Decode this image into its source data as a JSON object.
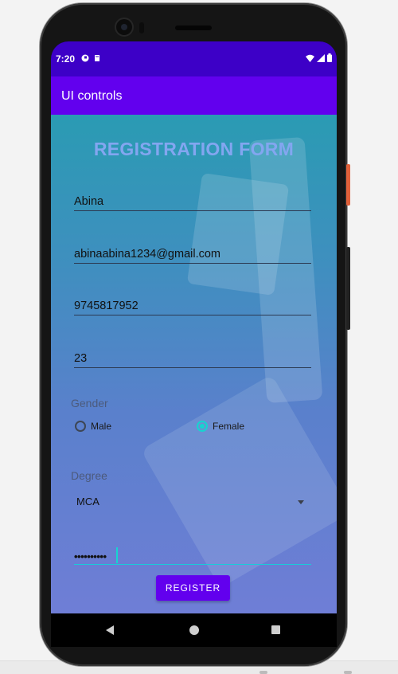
{
  "status_bar": {
    "time": "7:20"
  },
  "app_bar": {
    "title": "UI controls"
  },
  "form": {
    "title": "REGISTRATION FORM",
    "name": "Abina",
    "email": "abinaabina1234@gmail.com",
    "phone": "9745817952",
    "age": "23",
    "gender_label": "Gender",
    "gender_options": [
      {
        "label": "Male",
        "selected": false
      },
      {
        "label": "Female",
        "selected": true
      }
    ],
    "degree_label": "Degree",
    "degree_value": "MCA",
    "password_masked": "••••••••••",
    "register_label": "REGISTER"
  },
  "colors": {
    "status_bar": "#3d00c7",
    "app_bar": "#6200ee",
    "accent": "#16d4d0",
    "title": "#83a6f0"
  }
}
